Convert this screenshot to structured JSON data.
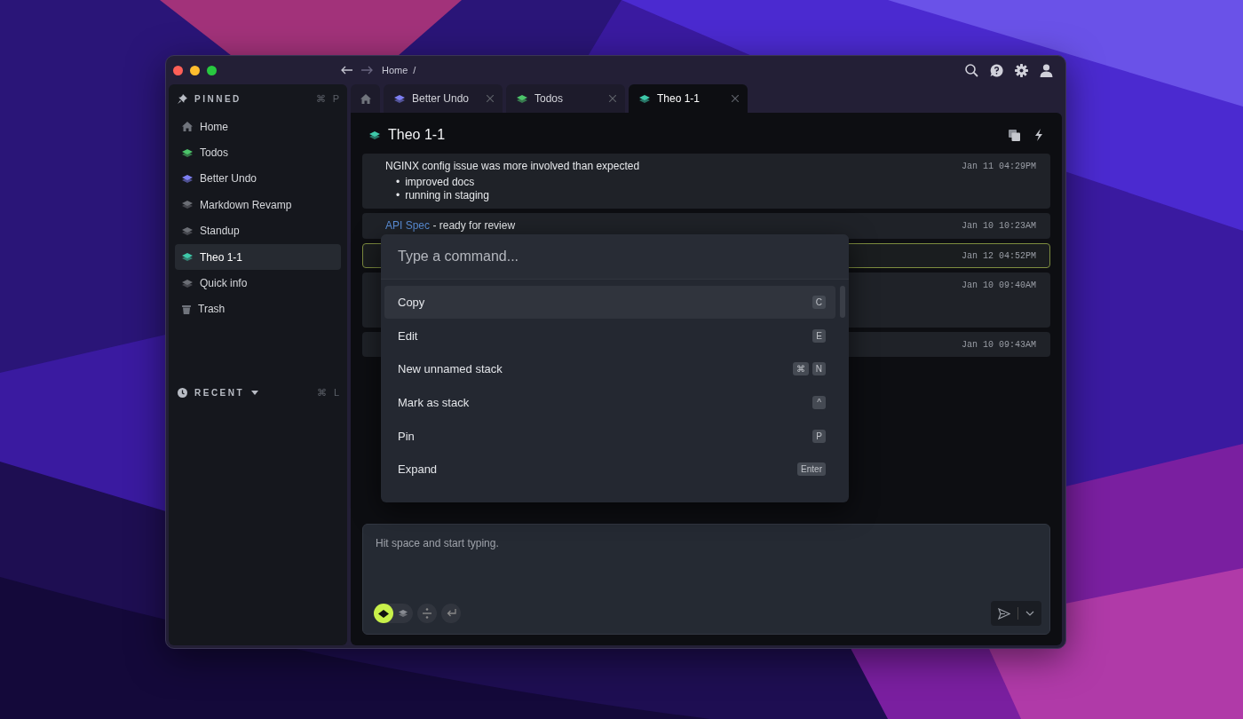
{
  "window": {
    "breadcrumb": [
      "Home",
      "/"
    ]
  },
  "sidebar": {
    "sections": [
      {
        "title": "PINNED",
        "keys": [
          "⌘",
          "P"
        ],
        "items": [
          {
            "label": "Home",
            "kind": "home",
            "selected": false
          },
          {
            "label": "Todos",
            "kind": "stack",
            "color": "#4cc46a",
            "selected": false
          },
          {
            "label": "Better Undo",
            "kind": "stack",
            "color": "#7d7ff2",
            "selected": false
          },
          {
            "label": "Markdown Revamp",
            "kind": "stack",
            "color": "#6b6e75",
            "selected": false
          },
          {
            "label": "Standup",
            "kind": "stack",
            "color": "#6b6e75",
            "selected": false
          },
          {
            "label": "Theo 1-1",
            "kind": "stack",
            "color": "#3ec9a9",
            "selected": true
          },
          {
            "label": "Quick info",
            "kind": "stack",
            "color": "#6b6e75",
            "selected": false
          },
          {
            "label": "Trash",
            "kind": "trash",
            "selected": false
          }
        ]
      },
      {
        "title": "RECENT",
        "keys": [
          "⌘",
          "L"
        ]
      }
    ]
  },
  "tabs": [
    {
      "kind": "home",
      "selected": false
    },
    {
      "kind": "stack",
      "label": "Better Undo",
      "color": "#7d7ff2",
      "selected": false
    },
    {
      "kind": "stack",
      "label": "Todos",
      "color": "#4cc46a",
      "selected": false
    },
    {
      "kind": "stack",
      "label": "Theo 1-1",
      "color": "#3ec9a9",
      "selected": true
    }
  ],
  "document": {
    "title": "Theo 1-1",
    "color": "#3ec9a9",
    "messages": [
      {
        "text": "NGINX config issue was more involved than expected",
        "bullets": [
          {
            "marker": "•",
            "text": "improved docs"
          },
          {
            "marker": "•",
            "text": "running in staging"
          }
        ],
        "time": "Jan 11 04:29PM",
        "selected": false
      },
      {
        "link": "API Spec",
        "text": "- ready for review",
        "time": "Jan 10 10:23AM",
        "selected": false
      },
      {
        "time": "Jan 12 04:52PM",
        "selected": true
      },
      {
        "time": "Jan 10 09:40AM",
        "selected": false
      },
      {
        "time": "Jan 10 09:43AM",
        "selected": false
      }
    ]
  },
  "command_palette": {
    "placeholder": "Type a command...",
    "commands": [
      {
        "label": "Copy",
        "keys": [
          "C"
        ],
        "selected": true
      },
      {
        "label": "Edit",
        "keys": [
          "E"
        ],
        "selected": false
      },
      {
        "label": "New unnamed stack",
        "keys": [
          "⌘",
          "N"
        ],
        "selected": false
      },
      {
        "label": "Mark as stack",
        "keys": [
          "^"
        ],
        "selected": false
      },
      {
        "label": "Pin",
        "keys": [
          "P"
        ],
        "selected": false
      },
      {
        "label": "Expand",
        "keys": [
          "Enter"
        ],
        "selected": false
      }
    ]
  },
  "composer": {
    "placeholder": "Hit space and start typing.",
    "modes": [
      {
        "kind": "diamond",
        "selected": true
      },
      {
        "kind": "stack",
        "selected": false
      }
    ]
  }
}
